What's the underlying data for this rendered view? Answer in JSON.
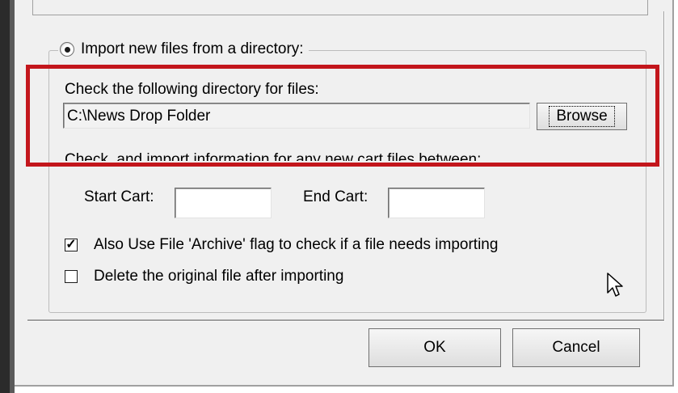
{
  "group": {
    "radio_label": "Import new files from a directory:",
    "radio_selected": true
  },
  "directory": {
    "label": "Check the following directory for files:",
    "path": "C:\\News Drop Folder",
    "browse_label": "Browse"
  },
  "cart_range": {
    "description": "Check, and import information for any new cart files between:",
    "start_label": "Start Cart:",
    "start_value": "",
    "end_label": "End Cart:",
    "end_value": ""
  },
  "options": {
    "archive_flag_label": "Also Use File 'Archive' flag to check if a file needs importing",
    "archive_flag_checked": true,
    "delete_label": "Delete the original file after importing",
    "delete_checked": false
  },
  "buttons": {
    "ok_label": "OK",
    "cancel_label": "Cancel"
  },
  "colors": {
    "highlight": "#c3161c",
    "dialog_bg": "#f0f0f0"
  }
}
